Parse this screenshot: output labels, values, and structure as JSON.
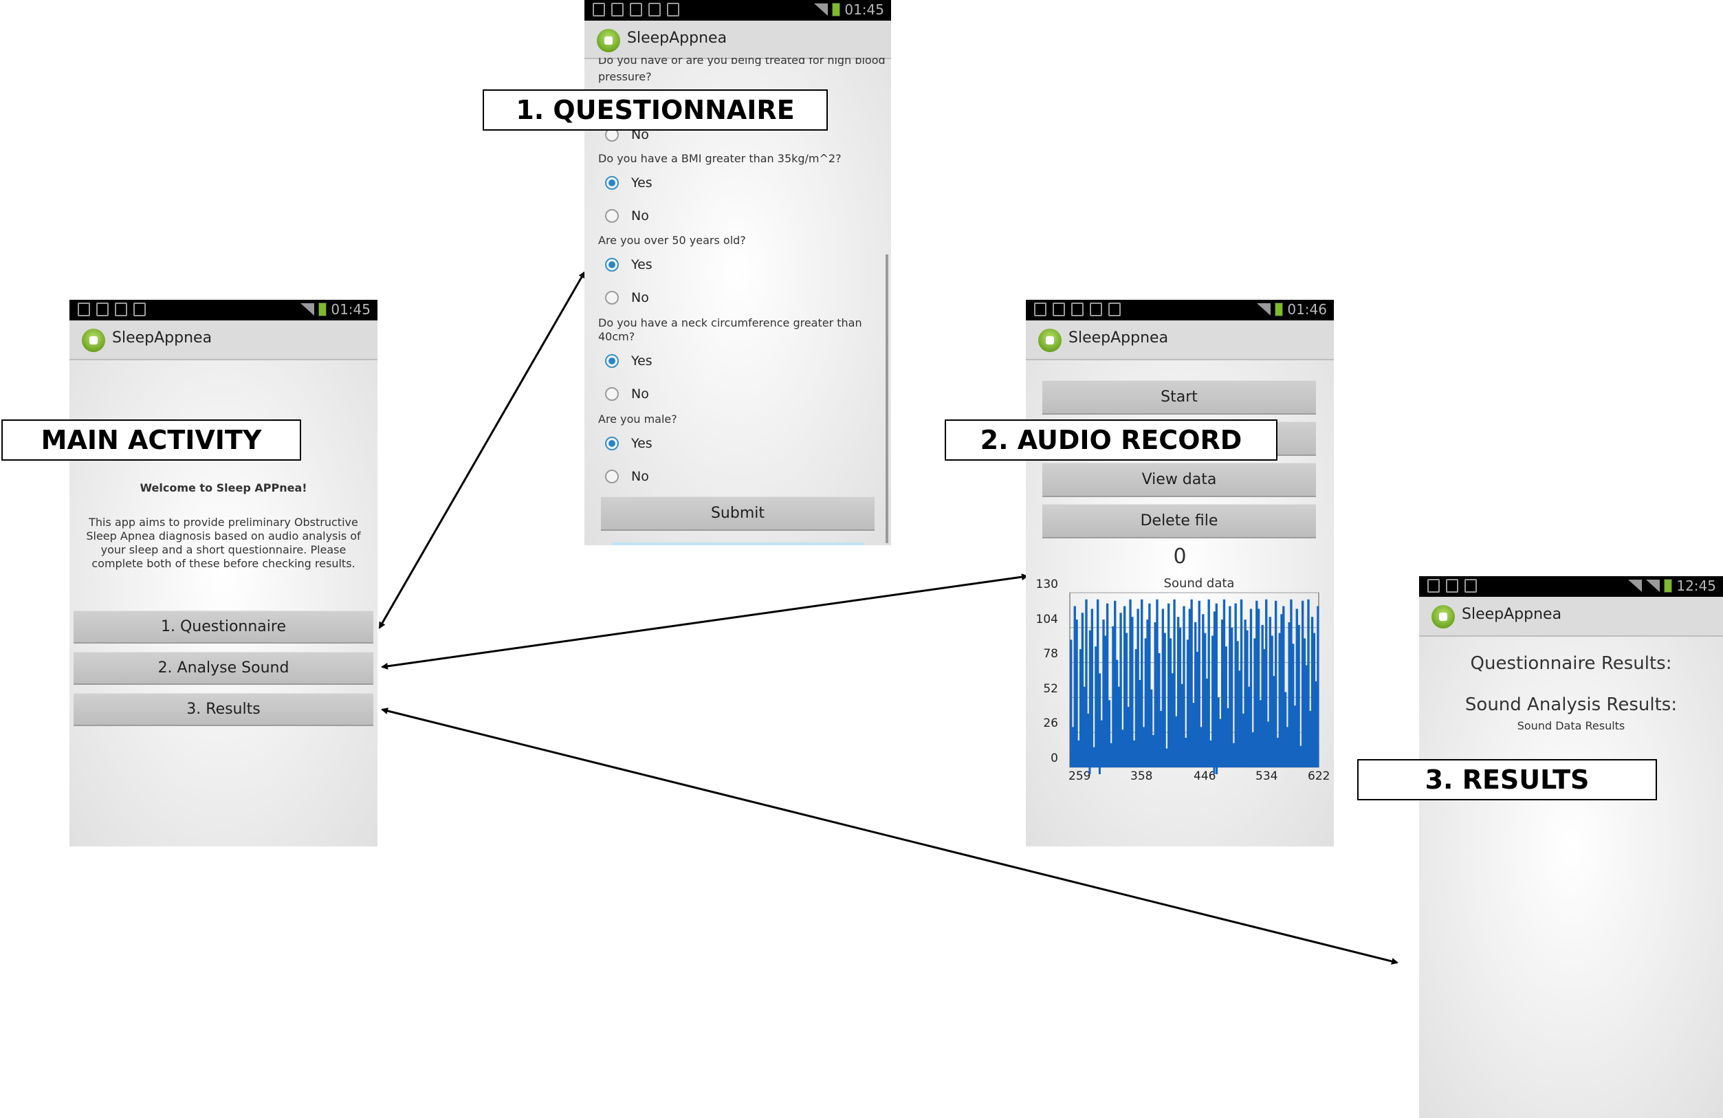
{
  "main": {
    "time": "01:45",
    "app_name": "SleepAppnea",
    "welcome": "Welcome to Sleep APPnea!",
    "description": [
      "This app aims to provide preliminary Obstructive",
      "Sleep Apnea diagnosis based on audio analysis of",
      "your sleep and a short questionnaire. Please",
      "complete both of these before checking results."
    ],
    "buttons": [
      "1. Questionnaire",
      "2. Analyse Sound",
      "3. Results"
    ],
    "label": "MAIN ACTIVITY"
  },
  "questionnaire": {
    "time": "01:45",
    "app_name": "SleepAppnea",
    "label": "1. QUESTIONNAIRE",
    "top_question_cut": "Do you have or are you being treated for high blood",
    "top_question_line2": "pressure?",
    "yes": "Yes",
    "no": "No",
    "questions": [
      "Do you have a BMI greater than 35kg/m^2?",
      "Are you over 50 years old?",
      "Do you have a neck circumference greater than",
      "Are you male?"
    ],
    "neck_line2": "40cm?",
    "submit": "Submit"
  },
  "audio": {
    "time": "01:46",
    "app_name": "SleepAppnea",
    "label": "2. AUDIO RECORD",
    "buttons": [
      "Start",
      "View data",
      "Delete file"
    ],
    "counter": "0"
  },
  "results": {
    "time": "12:45",
    "app_name": "SleepAppnea",
    "label": "3. RESULTS",
    "questionnaire_results": "Questionnaire Results:",
    "sound_results": "Sound Analysis Results:",
    "sound_data_results": "Sound Data Results"
  },
  "chart_data": {
    "type": "bar",
    "title": "Sound data",
    "yticks": [
      0,
      26,
      52,
      78,
      104,
      130
    ],
    "xticks": [
      259,
      358,
      446,
      534,
      622
    ],
    "ylim": [
      0,
      130
    ],
    "xlim": [
      259,
      622
    ],
    "values": [
      95,
      30,
      120,
      110,
      20,
      88,
      115,
      60,
      125,
      40,
      102,
      118,
      15,
      90,
      125,
      70,
      35,
      110,
      98,
      122,
      50,
      18,
      105,
      124,
      80,
      60,
      115,
      28,
      120,
      100,
      45,
      125,
      112,
      20,
      88,
      118,
      65,
      125,
      30,
      96,
      110,
      122,
      58,
      24,
      108,
      125,
      85,
      42,
      118,
      100,
      14,
      122,
      96,
      70,
      125,
      38,
      112,
      104,
      62,
      120,
      22,
      95,
      118,
      125,
      48,
      108,
      86,
      124,
      30,
      114,
      100,
      66,
      125,
      20,
      98,
      116,
      122,
      52,
      36,
      110,
      125,
      90,
      44,
      120,
      104,
      18,
      122,
      94,
      72,
      125,
      40,
      110,
      102,
      60,
      118,
      26,
      96,
      124,
      118,
      50,
      106,
      88,
      125,
      34,
      112,
      98,
      68,
      124,
      22,
      100,
      114,
      120,
      56,
      30,
      108,
      125,
      92,
      46,
      118,
      106,
      16,
      124,
      96,
      76,
      125,
      42,
      112,
      100,
      64,
      120
    ]
  }
}
